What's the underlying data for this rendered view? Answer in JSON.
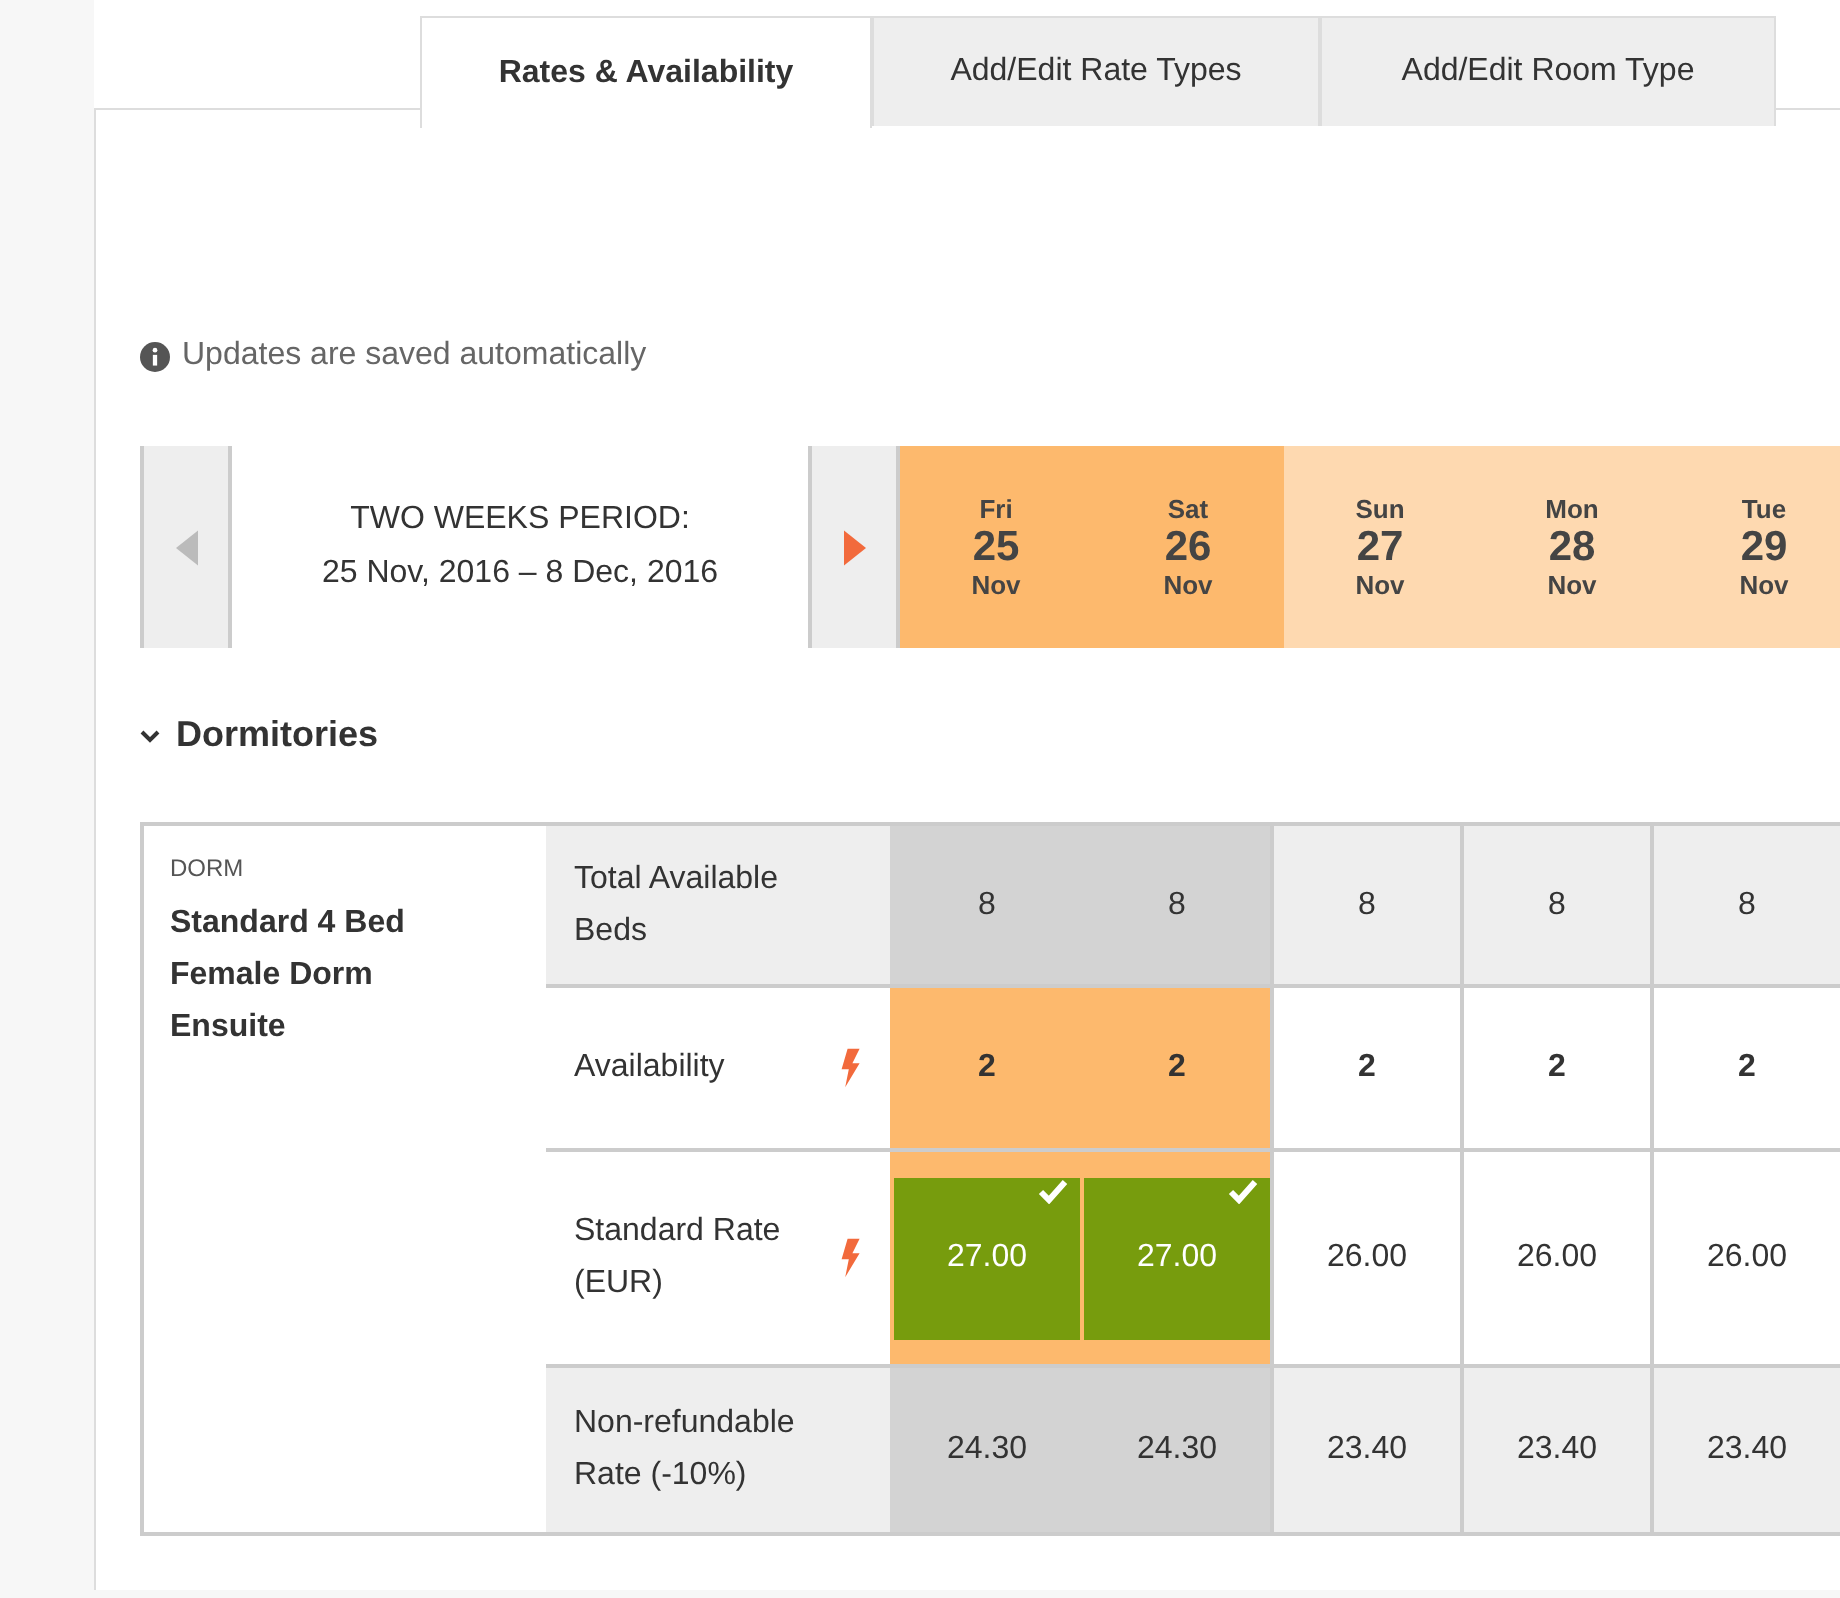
{
  "tabs": [
    {
      "label": "Rates & Availability",
      "selected": true
    },
    {
      "label": "Add/Edit Rate Types",
      "selected": false
    },
    {
      "label": "Add/Edit Room Type",
      "selected": false
    }
  ],
  "notice": "Updates are saved automatically",
  "period": {
    "title": "TWO WEEKS PERIOD:",
    "range": "25 Nov, 2016 – 8 Dec, 2016",
    "prev_disabled": true
  },
  "days": [
    {
      "dow": "Fri",
      "day": "25",
      "month": "Nov",
      "weekend": true
    },
    {
      "dow": "Sat",
      "day": "26",
      "month": "Nov",
      "weekend": true
    },
    {
      "dow": "Sun",
      "day": "27",
      "month": "Nov",
      "weekend": false
    },
    {
      "dow": "Mon",
      "day": "28",
      "month": "Nov",
      "weekend": false
    },
    {
      "dow": "Tue",
      "day": "29",
      "month": "Nov",
      "weekend": false
    }
  ],
  "section": {
    "title": "Dormitories",
    "expanded": true
  },
  "room": {
    "type": "DORM",
    "name": "Standard 4 Bed Female Dorm Ensuite"
  },
  "rows": [
    {
      "kind": "total",
      "label": "Total Available Beds",
      "bolt": false,
      "cells": [
        {
          "value": "8",
          "saved": false
        },
        {
          "value": "8",
          "saved": false
        },
        {
          "value": "8",
          "saved": false
        },
        {
          "value": "8",
          "saved": false
        },
        {
          "value": "8",
          "saved": false
        }
      ]
    },
    {
      "kind": "availability",
      "label": "Availability",
      "bolt": true,
      "cells": [
        {
          "value": "2",
          "saved": false
        },
        {
          "value": "2",
          "saved": false
        },
        {
          "value": "2",
          "saved": false
        },
        {
          "value": "2",
          "saved": false
        },
        {
          "value": "2",
          "saved": false
        }
      ]
    },
    {
      "kind": "rate",
      "label": "Standard Rate (EUR)",
      "bolt": true,
      "cells": [
        {
          "value": "27.00",
          "saved": true
        },
        {
          "value": "27.00",
          "saved": true
        },
        {
          "value": "26.00",
          "saved": false
        },
        {
          "value": "26.00",
          "saved": false
        },
        {
          "value": "26.00",
          "saved": false
        }
      ]
    },
    {
      "kind": "derived",
      "label": "Non-refundable Rate (-10%)",
      "bolt": false,
      "cells": [
        {
          "value": "24.30",
          "saved": false
        },
        {
          "value": "24.30",
          "saved": false
        },
        {
          "value": "23.40",
          "saved": false
        },
        {
          "value": "23.40",
          "saved": false
        },
        {
          "value": "23.40",
          "saved": false
        }
      ]
    }
  ]
}
